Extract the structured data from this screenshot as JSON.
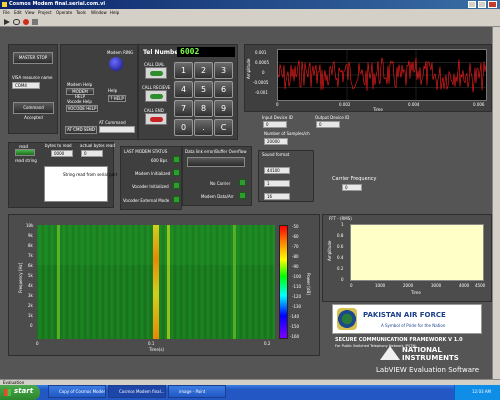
{
  "window": {
    "title": "Cosmos Modem final.serial.com.vi",
    "menu": [
      "File",
      "Edit",
      "View",
      "Project",
      "Operate",
      "Tools",
      "Window",
      "Help"
    ]
  },
  "top_left": {
    "master_stop": "MASTER STOP",
    "visa_label": "VISA resource name",
    "visa_value": "COM4",
    "cmd_accepted": "Command Accepted"
  },
  "modem": {
    "ring_label": "Modem RING",
    "help_label": "Modem Help",
    "help_value": "MODEM HELP",
    "vhelp_label": "Vocode Help",
    "vhelp_value": "VOCODE HELP",
    "help": "Help",
    "help_btn": "? HELP",
    "at_cmd_label": "AT Command",
    "at_cmd_send": "AT CMD SEND"
  },
  "phone": {
    "tel_label": "Tel Number",
    "tel_value": "6002",
    "call_dial": "CALL DIAL",
    "call_receive": "CALL RECIEVE",
    "call_end": "CALL END",
    "keys": [
      "1",
      "2",
      "3",
      "4",
      "5",
      "6",
      "7",
      "8",
      "9",
      "0",
      ".",
      "C"
    ]
  },
  "io": {
    "read": "read",
    "bytes_to_read": "bytes to read",
    "bytes_to_read_value": "0000",
    "actual_bytes_read": "actual bytes read",
    "actual_bytes_value": "0",
    "read_string": "read string",
    "string_placeholder": "String read from serial port"
  },
  "status": {
    "title": "LAST MODEM STATUS",
    "items": [
      "600 Bps",
      "Modem Initialized",
      "Vocoder Initialized",
      "Vocoder External Mode"
    ]
  },
  "buffer": {
    "title": "Data link error/Buffer Overflow",
    "no_carrier": "No Carrier",
    "modem_data": "Modem Data/Arr"
  },
  "waveform": {
    "ylabel": "Amplitude",
    "xlabel": "Time",
    "y_ticks": [
      "0.001",
      "0.0005",
      "0",
      "-0.0005",
      "-0.001"
    ],
    "x_ticks": [
      "0",
      "0.002",
      "0.004",
      "0.006"
    ]
  },
  "devices": {
    "input_label": "Input Device ID",
    "input_value": "0",
    "output_label": "Output Device ID",
    "output_value": "0",
    "samples_label": "Number of Samples/ch",
    "samples_value": "20000"
  },
  "sound": {
    "title": "Sound format",
    "rate": "44100",
    "ch": "1",
    "bits": "16",
    "carrier_label": "Carrier Frequency",
    "carrier_value": "0"
  },
  "spectrogram": {
    "ylabel": "Frequency [Hz]",
    "xlabel": "Time(s)",
    "y_ticks": [
      "10k",
      "9k",
      "8k",
      "7k",
      "6k",
      "5k",
      "4k",
      "3k",
      "2k",
      "1k",
      "0"
    ],
    "x_ticks": [
      "0",
      "0.1",
      "0.2"
    ],
    "scale_ticks": [
      "-50",
      "-60",
      "-70",
      "-80",
      "-90",
      "-100",
      "-110",
      "-120",
      "-130",
      "-140",
      "-150",
      "-160"
    ],
    "scale_label": "Power [dB]"
  },
  "fft": {
    "title": "FFT - (RMS)",
    "ylabel": "Amplitude",
    "xlabel": "Time",
    "y_ticks": [
      "1",
      "0.8",
      "0.6",
      "0.4",
      "0.2",
      "0"
    ],
    "x_ticks": [
      "0",
      "1000",
      "2000",
      "3000",
      "4000",
      "4500"
    ]
  },
  "branding": {
    "org": "PAKISTAN AIR FORCE",
    "tagline": "A Symbol of Pride for the Nation",
    "framework": "SECURE COMMUNICATION FRAMEWORK V 1.0",
    "framework_sub": "For Public Switched Telephony Network (PSTN)",
    "ni_top": "NATIONAL",
    "ni_bottom": "INSTRUMENTS",
    "labview": "LabVIEW Evaluation Software"
  },
  "statusbar": {
    "text": "Evaluation"
  },
  "taskbar": {
    "start": "start",
    "items": [
      "Copy of Cosmos Modem",
      "Cosmos Modem final...",
      "image - Paint"
    ],
    "clock": "12:03 AM"
  },
  "colors": {
    "titlebar": "#0a246a",
    "panel": "#3f3f3f",
    "led_green": "#2f9c2f",
    "lcd_green": "#7dff4a",
    "plot_bg": "#000000",
    "fft_bg": "#ffffc8",
    "wave": "#ff2020"
  }
}
